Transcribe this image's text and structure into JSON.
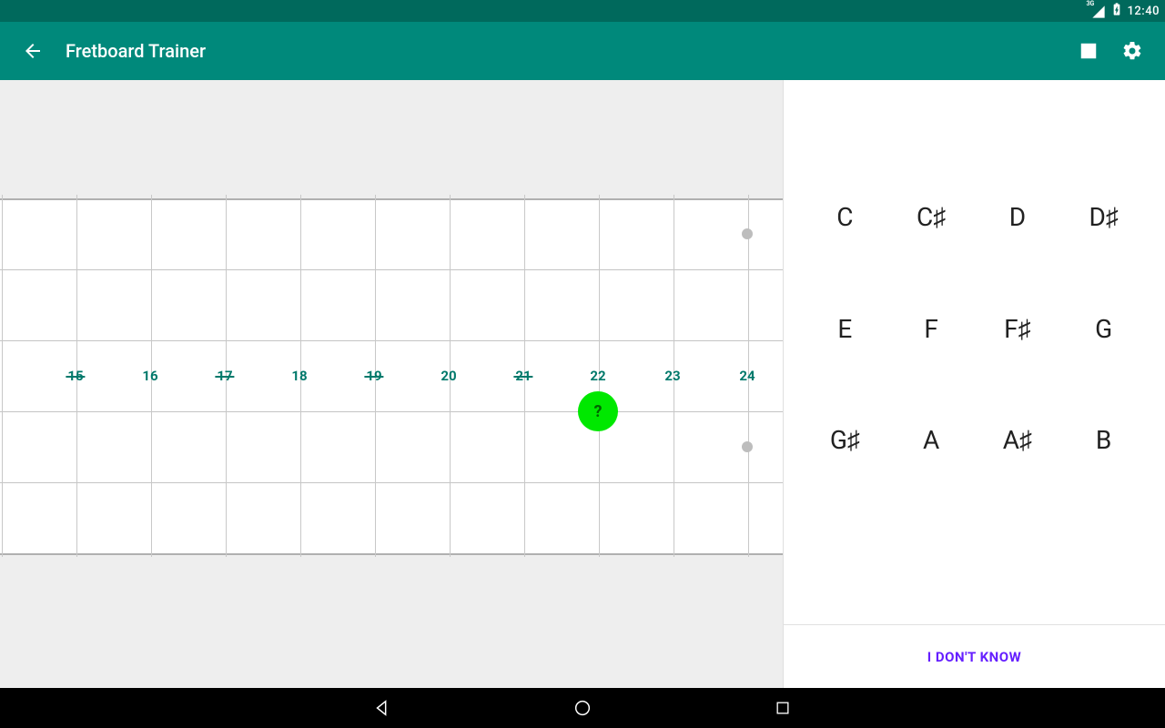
{
  "status": {
    "network": "3G",
    "time": "12:40"
  },
  "appbar": {
    "title": "Fretboard Trainer"
  },
  "fretboard": {
    "fret_numbers": [
      15,
      16,
      17,
      18,
      19,
      20,
      21,
      22,
      23,
      24
    ],
    "struck_frets": [
      15,
      17,
      19,
      21
    ],
    "target": {
      "label": "?",
      "fret_index": 7,
      "string_index": 3
    },
    "inlays": [
      {
        "fret_index": 9,
        "string_index": 1
      },
      {
        "fret_index": 9,
        "string_index": 4
      }
    ]
  },
  "notes": [
    "C",
    "C♯",
    "D",
    "D♯",
    "E",
    "F",
    "F♯",
    "G",
    "G♯",
    "A",
    "A♯",
    "B"
  ],
  "actions": {
    "dont_know": "I DON'T KNOW"
  },
  "colors": {
    "primary": "#00897b",
    "primary_dark": "#00695c",
    "accent": "#651fff",
    "target": "#00e800"
  }
}
